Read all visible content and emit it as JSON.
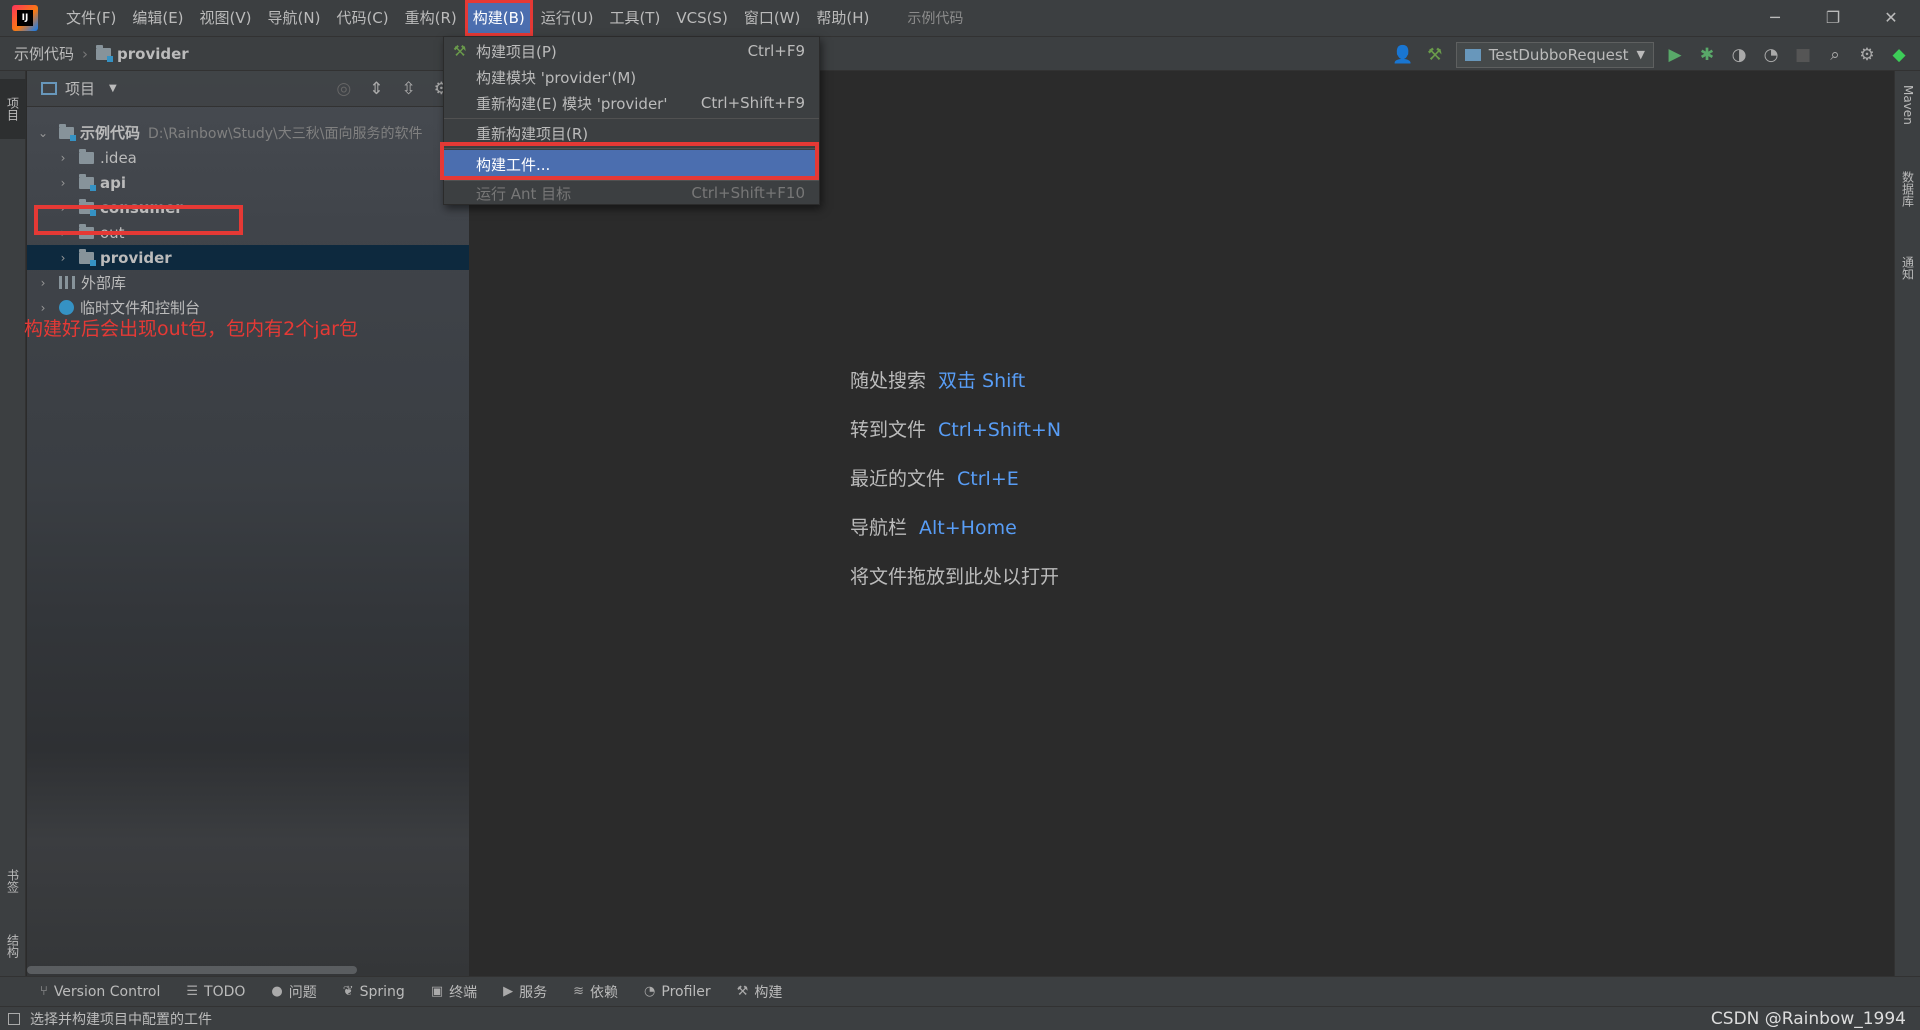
{
  "menubar": {
    "items": [
      "文件(F)",
      "编辑(E)",
      "视图(V)",
      "导航(N)",
      "代码(C)",
      "重构(R)",
      "构建(B)",
      "运行(U)",
      "工具(T)",
      "VCS(S)",
      "窗口(W)",
      "帮助(H)"
    ],
    "active_index": 6,
    "project_title": "示例代码"
  },
  "window_controls": [
    "─",
    "❐",
    "✕"
  ],
  "navbar": {
    "breadcrumb": [
      "示例代码",
      "provider"
    ],
    "run_config": "TestDubboRequest"
  },
  "left_strip": {
    "project_tab": "项目",
    "bookmarks_tab": "书签",
    "structure_tab": "结构"
  },
  "project_panel": {
    "title": "项目",
    "tree": [
      {
        "label": "示例代码",
        "path": "D:\\Rainbow\\Study\\大三秋\\面向服务的软件",
        "expanded": true,
        "level": 0,
        "bold": true
      },
      {
        "label": ".idea",
        "level": 1,
        "bold": false
      },
      {
        "label": "api",
        "level": 1,
        "bold": true
      },
      {
        "label": "consumer",
        "level": 1,
        "bold": true
      },
      {
        "label": "out",
        "level": 1,
        "bold": false
      },
      {
        "label": "provider",
        "level": 1,
        "bold": true,
        "selected": true
      },
      {
        "label": "外部库",
        "level": 0
      },
      {
        "label": "临时文件和控制台",
        "level": 0
      }
    ],
    "annotation": "构建好后会出现out包，包内有2个jar包"
  },
  "build_menu": {
    "items": [
      {
        "label": "构建项目(P)",
        "shortcut": "Ctrl+F9"
      },
      {
        "label": "构建模块 'provider'(M)",
        "shortcut": ""
      },
      {
        "label": "重新构建(E) 模块 'provider'",
        "shortcut": "Ctrl+Shift+F9"
      },
      {
        "label": "重新构建项目(R)",
        "shortcut": ""
      },
      {
        "label": "构建工件...",
        "shortcut": "",
        "highlighted": true
      },
      {
        "label": "运行 Ant 目标",
        "shortcut": "Ctrl+Shift+F10",
        "disabled": true
      }
    ]
  },
  "editor_hints": [
    {
      "label": "随处搜索",
      "key": "双击 Shift"
    },
    {
      "label": "转到文件",
      "key": "Ctrl+Shift+N"
    },
    {
      "label": "最近的文件",
      "key": "Ctrl+E"
    },
    {
      "label": "导航栏",
      "key": "Alt+Home"
    },
    {
      "label": "将文件拖放到此处以打开",
      "key": ""
    }
  ],
  "right_strip": {
    "maven_tab": "Maven",
    "database_tab": "数据库",
    "notifications_tab": "通知"
  },
  "bottom_bar": [
    {
      "icon": "version-control-icon",
      "label": "Version Control"
    },
    {
      "icon": "todo-icon",
      "label": "TODO"
    },
    {
      "icon": "problems-icon",
      "label": "问题"
    },
    {
      "icon": "spring-icon",
      "label": "Spring"
    },
    {
      "icon": "terminal-icon",
      "label": "终端"
    },
    {
      "icon": "services-icon",
      "label": "服务"
    },
    {
      "icon": "dependencies-icon",
      "label": "依赖"
    },
    {
      "icon": "profiler-icon",
      "label": "Profiler"
    },
    {
      "icon": "build-icon",
      "label": "构建"
    }
  ],
  "status_bar": {
    "text": "选择并构建项目中配置的工件",
    "watermark": "CSDN @Rainbow_1994"
  },
  "colors": {
    "highlight_red": "#e53935",
    "selection_blue": "#4b6eaf",
    "link_blue": "#589df6"
  }
}
